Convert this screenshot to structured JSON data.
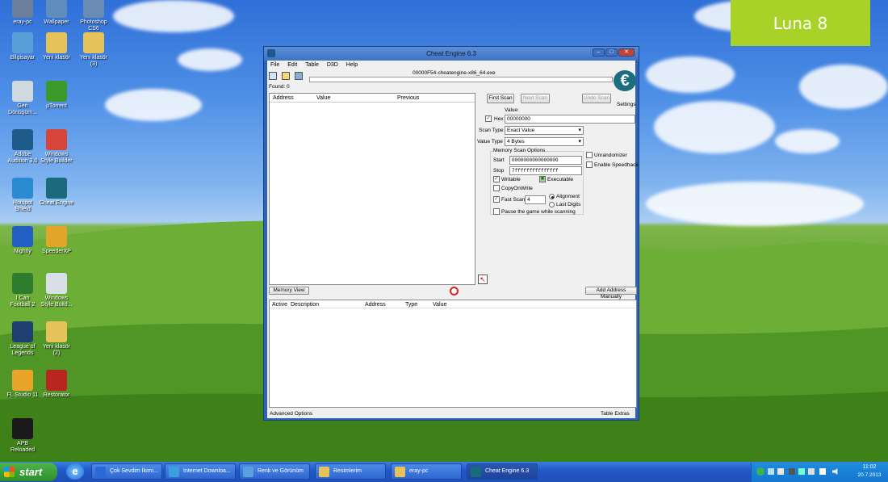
{
  "watermark": "Luna 8",
  "desktop_icons": [
    {
      "label": "eray-pc",
      "color": "#6b7f9a"
    },
    {
      "label": "Wallpaper",
      "color": "#5f8dbd"
    },
    {
      "label": "Photoshop\nCS6",
      "color": "#6a8cb4"
    },
    {
      "label": "Bilgisayar",
      "color": "#5aa0d8"
    },
    {
      "label": "Yeni klasör",
      "color": "#e6c35a"
    },
    {
      "label": "Yeni klasör\n(3)",
      "color": "#e6c35a"
    },
    {
      "label": "Geri\nDönüşüm...",
      "color": "#d0d8e0"
    },
    {
      "label": "µTorrent",
      "color": "#3a9a2a"
    },
    {
      "label": "Adobe\nAudition 3.0",
      "color": "#1f5b8a"
    },
    {
      "label": "Windows\nStyle Builder",
      "color": "#d7443a"
    },
    {
      "label": "Hotspot\nShield",
      "color": "#2b8bd1"
    },
    {
      "label": "Cheat Engine",
      "color": "#1a6a7c"
    },
    {
      "label": "Nightly",
      "color": "#2460c4"
    },
    {
      "label": "SpeederXP",
      "color": "#e2a52a"
    },
    {
      "label": "I Can\nFootball 2",
      "color": "#2e7d2e"
    },
    {
      "label": "Windows\nStyle Build...",
      "color": "#d9dfe6"
    },
    {
      "label": "League of\nLegends",
      "color": "#1f3f6e"
    },
    {
      "label": "Yeni klasör\n(2)",
      "color": "#e6c35a"
    },
    {
      "label": "FL Studio 11",
      "color": "#e9a42a"
    },
    {
      "label": "Restorator",
      "color": "#b8261f"
    },
    {
      "label": "APB\nReloaded",
      "color": "#1a1a1a"
    }
  ],
  "window": {
    "title": "Cheat Engine 6.3",
    "menu": [
      "File",
      "Edit",
      "Table",
      "D3D",
      "Help"
    ],
    "process": "00000F54-cheatengine-x86_64.exe",
    "found": "Found: 0",
    "list_headers": [
      "Address",
      "Value",
      "Previous"
    ],
    "first_scan": "First Scan",
    "next_scan": "Next Scan",
    "undo_scan": "Undo Scan",
    "settings": "Settings",
    "value_label": "Value:",
    "hex_label": "Hex",
    "value": "00000000",
    "scan_type_label": "Scan Type",
    "scan_type": "Exact Value",
    "value_type_label": "Value Type",
    "value_type": "4 Bytes",
    "memory_options": "Memory Scan Options",
    "start_label": "Start",
    "start_value": "0000000000000000",
    "stop_label": "Stop",
    "stop_value": "7fffffffffffffff",
    "writable": "Writable",
    "executable": "Executable",
    "copyonwrite": "CopyOnWrite",
    "fast_scan": "Fast Scan",
    "fast_scan_value": "4",
    "alignment": "Alignment",
    "last_digits": "Last Digits",
    "pause": "Pause the game while scanning",
    "unrandomizer": "Unrandomizer",
    "speedhack": "Enable Speedhack",
    "memory_view": "Memory View",
    "add_address": "Add Address Manually",
    "table_headers": [
      "Active",
      "Description",
      "Address",
      "Type",
      "Value"
    ],
    "advanced": "Advanced Options",
    "table_extras": "Table Extras"
  },
  "taskbar": {
    "start": "start",
    "items": [
      "Çok Sevdim İkimi...",
      "Internet Downloa...",
      "Renk ve Görünüm",
      "Resimlerim",
      "eray-pc",
      "Cheat Engine 6.3"
    ],
    "time": "11:02",
    "date": "20.7.2013"
  }
}
